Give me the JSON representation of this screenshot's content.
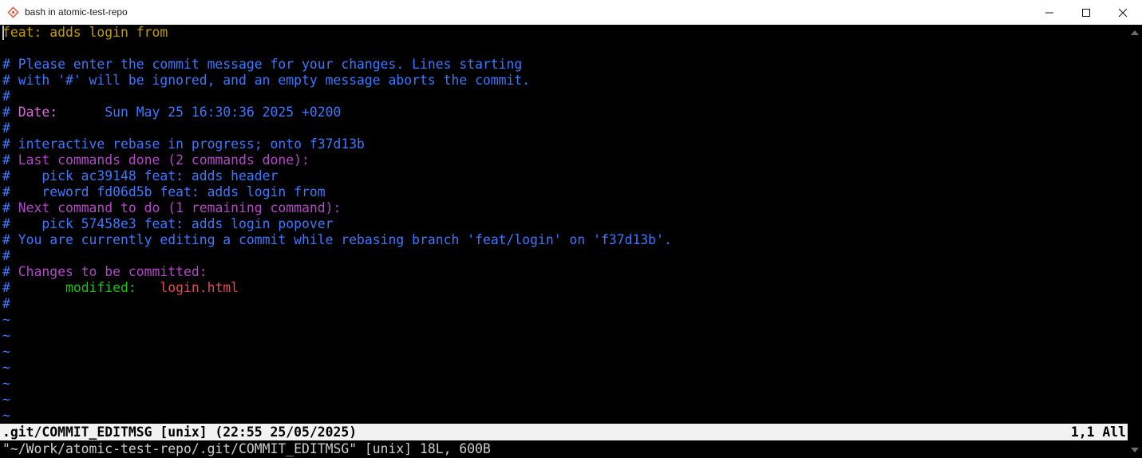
{
  "window": {
    "title": "bash in atomic-test-repo",
    "app_icon": "git-bash-icon",
    "controls": [
      "minimize-icon",
      "maximize-icon",
      "close-icon"
    ]
  },
  "editor": {
    "lines": [
      {
        "text": "feat: adds login from",
        "color": "#c19c00"
      },
      {
        "text": "",
        "color": "#3b78ff"
      },
      {
        "text": "# Please enter the commit message for your changes. Lines starting",
        "color": "#3b78ff"
      },
      {
        "text": "# with '#' will be ignored, and an empty message aborts the commit.",
        "color": "#3b78ff"
      },
      {
        "text": "#",
        "color": "#3b78ff"
      },
      {
        "text": "# Date:      Sun May 25 16:30:36 2025 +0200",
        "color": "#3b78ff"
      },
      {
        "text": "#",
        "color": "#3b78ff"
      },
      {
        "text": "# interactive rebase in progress; onto f37d13b",
        "color": "#3b78ff"
      },
      {
        "text": "# Last commands done (2 commands done):",
        "color": "#3b78ff"
      },
      {
        "text": "#    pick ac39148 feat: adds header",
        "color": "#3b78ff"
      },
      {
        "text": "#    reword fd06d5b feat: adds login from",
        "color": "#3b78ff"
      },
      {
        "text": "# Next command to do (1 remaining command):",
        "color": "#3b78ff"
      },
      {
        "text": "#    pick 57458e3 feat: adds login popover",
        "color": "#3b78ff"
      },
      {
        "text": "# You are currently editing a commit while rebasing branch 'feat/login' on 'f37d13b'.",
        "color": "#3b78ff"
      },
      {
        "text": "#",
        "color": "#3b78ff"
      },
      {
        "text": "# Changes to be committed:",
        "color": "#3b78ff"
      },
      {
        "text": "#       modified:   login.html",
        "color": "#3b78ff"
      },
      {
        "text": "#",
        "color": "#3b78ff"
      }
    ],
    "segments": {
      "date_key": "Date:",
      "date_value": "Sun May 25 16:30:36 2025 +0200",
      "last_commands": "Last commands done (2 commands done):",
      "next_command": "Next command to do (1 remaining command):",
      "changes_header": "Changes to be committed:",
      "modified_label": "modified:",
      "modified_file": "login.html"
    },
    "tilde_lines": [
      "~",
      "~",
      "~",
      "~",
      "~",
      "~",
      "~"
    ]
  },
  "status": {
    "left": ".git/COMMIT_EDITMSG [unix] (22:55 25/05/2025)",
    "right": "1,1 All"
  },
  "cmdline": "\"~/Work/atomic-test-repo/.git/COMMIT_EDITMSG\" [unix] 18L, 600B",
  "colors": {
    "comment": "#3b78ff",
    "subject": "#c19c00",
    "section": "#b148c6",
    "modified": "#16c60c",
    "file": "#e74856",
    "status_bg": "#f2f2f2"
  }
}
